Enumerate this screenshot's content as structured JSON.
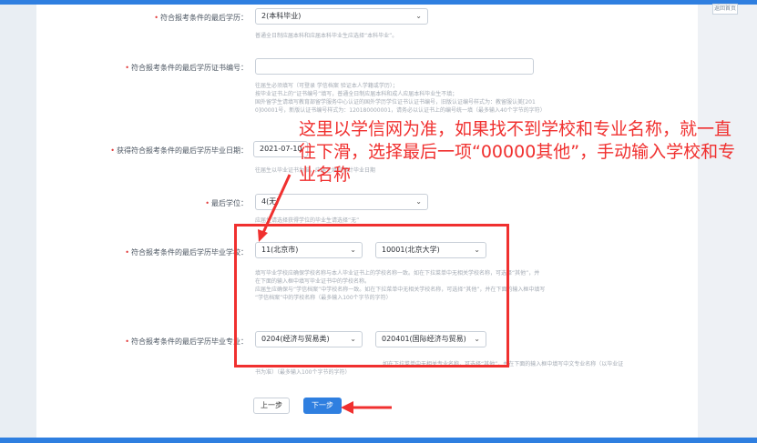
{
  "right_panel": {
    "button_label": "返回首页"
  },
  "form": {
    "degree": {
      "label": "符合报考条件的最后学历：",
      "value": "2(本科毕业)",
      "hint": "普通全日制应届本科和应届本科毕业生应选择“本科毕业”。"
    },
    "cert_no": {
      "label": "符合报考条件的最后学历证书编号：",
      "value": "",
      "hint_lines": [
        "往届生必须填写（可登录 学信档案 验证本人学籍或学历）；",
        "按毕业证书上的“证书编号”填写，普通全日制应届本科和成人应届本科毕业生不填；",
        "国外留学生请填写教育部留学服务中心认证的国外学历学位证书认证书编号，旧版认证编号样式为：教留服认美[201",
        "0]00001号，新版认证书编号样式为：120180000001，请务必以认证书上的编号统一填（最多输入40个字节的字符）"
      ]
    },
    "grad_date": {
      "label": "获得符合报考条件的最后学历毕业日期：",
      "value": "2021-07-10",
      "hint": "往届生以毕业证书为准，应届生填写预计毕业日期"
    },
    "last_degree": {
      "label": "最后学位：",
      "value": "4(无)",
      "hint": "应届生请选择获得学位的毕业生请选择“无”"
    },
    "school": {
      "label": "符合报考条件的最后学历毕业学校：",
      "province_value": "11(北京市)",
      "school_value": "10001(北京大学)",
      "hint_lines": [
        "填写毕业学校应确保学校名称与本人毕业证书上的学校名称一致。如在下拉菜单中无相关学校名称，可选择“其他”，并",
        "在下面的输入框中填写毕业证书中的学校名称。",
        "应届生应确保与“学信档案”中学校名称一致。如在下拉菜单中无相关学校名称，可选择“其他”，并在下面的输入框中填写",
        "“学信档案”中的学校名称（最多输入100个字节的字符）"
      ]
    },
    "major": {
      "label": "符合报考条件的最后学历毕业专业：",
      "category_value": "0204(经济与贸易类)",
      "major_value": "020401(国际经济与贸易)",
      "hint_lines": [
        "如在下拉菜单中无相关专业名称，可选择“其他”，并在下面的输入框中填写中文专业名称（以毕业证",
        "书为准）（最多输入100个字节的字符）"
      ]
    }
  },
  "buttons": {
    "prev": "上一步",
    "next": "下一步"
  },
  "annotation": {
    "text": "这里以学信网为准，如果找不到学校和专业名称，就一直往下滑，选择最后一项“00000其他”，手动输入学校和专业名称",
    "color": "#f0302f"
  },
  "colors": {
    "accent": "#2f7fe0",
    "required": "#e23b3b"
  }
}
